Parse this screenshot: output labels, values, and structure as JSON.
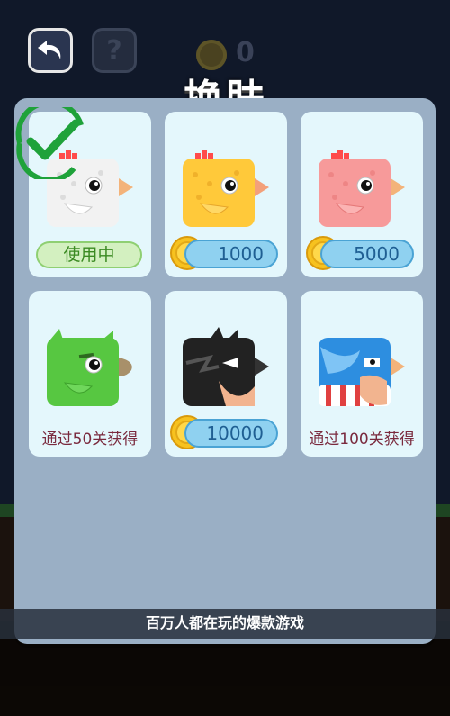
{
  "title": "换肤",
  "coin_count": "0",
  "banner_text": "百万人都在玩的爆款游戏",
  "skins": [
    {
      "name": "white-chicken",
      "body": "#f2f2f2",
      "shade": "#cfcfcf",
      "status": "使用中",
      "price": null
    },
    {
      "name": "yellow-chicken",
      "body": "#ffc93a",
      "shade": "#f0a520",
      "status": null,
      "price": "1000"
    },
    {
      "name": "pink-chicken",
      "body": "#f79a9a",
      "shade": "#e57878",
      "status": null,
      "price": "5000"
    },
    {
      "name": "green-bird",
      "body": "#57c741",
      "shade": "#3ea22c",
      "status": null,
      "unlock": "通过50关获得"
    },
    {
      "name": "black-bird",
      "body": "#222222",
      "shade": "#111111",
      "status": null,
      "price": "10000"
    },
    {
      "name": "blue-hero-bird",
      "body": "#2d8ee0",
      "shade": "#1c6fb8",
      "status": null,
      "unlock": "通过100关获得"
    }
  ]
}
